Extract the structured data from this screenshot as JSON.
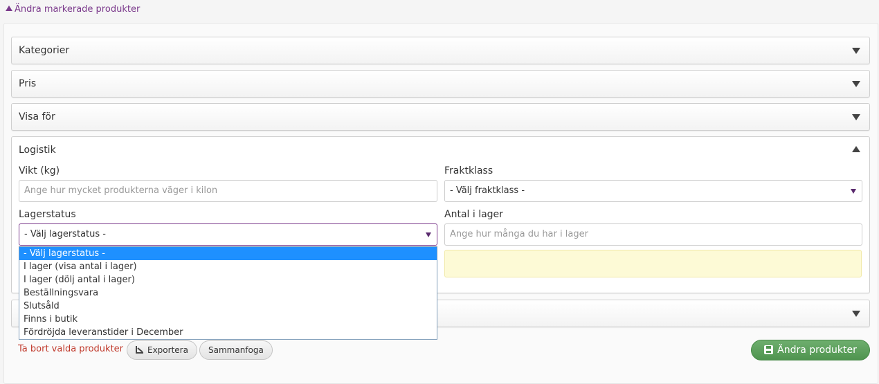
{
  "toggle": {
    "label": "Ändra markerade produkter"
  },
  "panels": {
    "kategorier": "Kategorier",
    "pris": "Pris",
    "visa_for": "Visa för",
    "logistik": "Logistik"
  },
  "logistik": {
    "vikt_label": "Vikt (kg)",
    "vikt_placeholder": "Ange hur mycket produkterna väger i kilon",
    "fraktklass_label": "Fraktklass",
    "fraktklass_value": "- Välj fraktklass -",
    "lagerstatus_label": "Lagerstatus",
    "lagerstatus_value": "- Välj lagerstatus -",
    "antal_label": "Antal i lager",
    "antal_placeholder": "Ange hur många du har i lager"
  },
  "lagerstatus_options": [
    "- Välj lagerstatus -",
    "I lager (visa antal i lager)",
    "I lager (dölj antal i lager)",
    "Beställningsvara",
    "Slutsåld",
    "Finns i butik",
    "Fördröjda leveranstider i December"
  ],
  "footer": {
    "delete_link": "Ta bort valda produkter",
    "export_label": "Exportera",
    "merge_label": "Sammanfoga",
    "submit_label": "Ändra produkter"
  },
  "colors": {
    "accent": "#7b3a8c",
    "danger": "#c0392b",
    "success": "#5a9e5a",
    "selection": "#1e90ff"
  }
}
